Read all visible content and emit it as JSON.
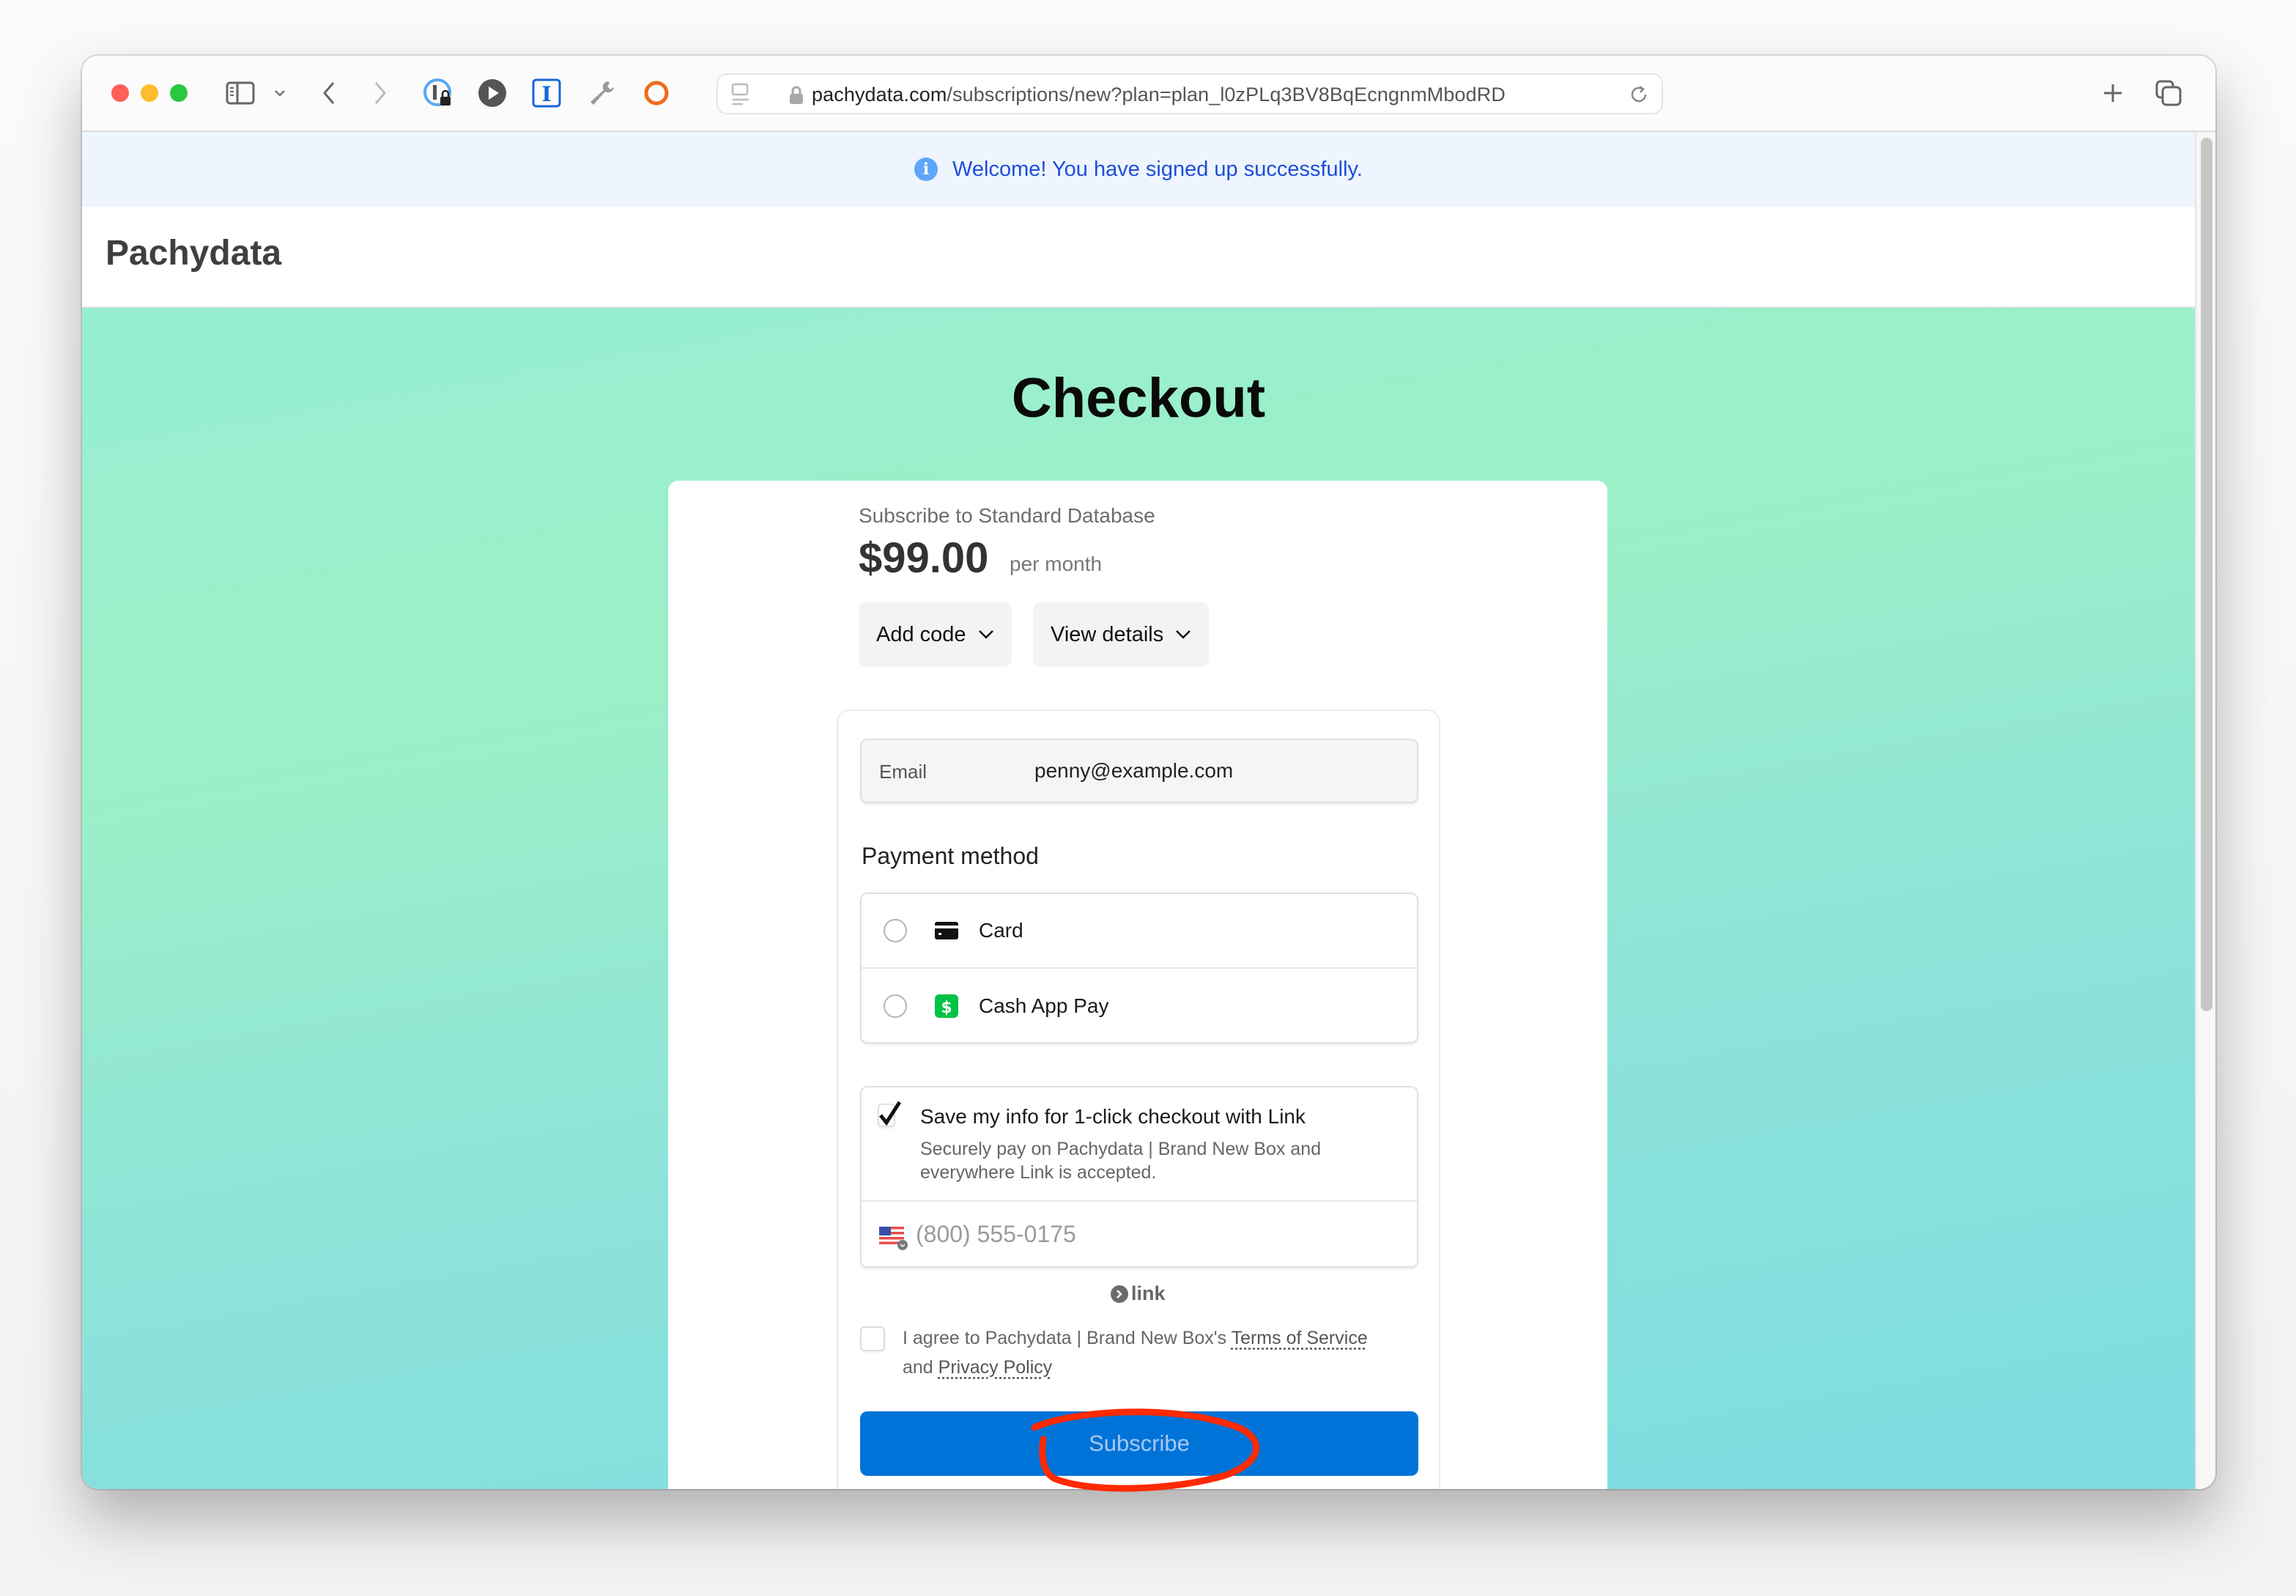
{
  "browser": {
    "url_host": "pachydata.com",
    "url_path": "/subscriptions/new?plan=plan_l0zPLq3BV8BqEcngnmMbodRD",
    "toolbar_icons": [
      "sidebar-icon",
      "chevron-down-icon",
      "back-icon",
      "forward-icon",
      "password-manager-icon",
      "play-icon",
      "text-cursor-icon",
      "wrench-icon",
      "circle-icon"
    ],
    "right_icons": [
      "new-tab-icon",
      "tab-overview-icon"
    ]
  },
  "flash": {
    "icon": "info-icon",
    "message": "Welcome! You have signed up successfully.",
    "color": "#1d4ed8"
  },
  "navbar": {
    "brand": "Pachydata"
  },
  "page": {
    "title": "Checkout"
  },
  "summary": {
    "subscribe_label": "Subscribe to Standard Database",
    "price": "$99.00",
    "interval": "per month",
    "add_code_label": "Add code",
    "view_details_label": "View details"
  },
  "form": {
    "email_label": "Email",
    "email_value": "penny@example.com",
    "payment_method_heading": "Payment method",
    "payment_methods": [
      {
        "label": "Card",
        "icon": "credit-card-icon",
        "selected": false
      },
      {
        "label": "Cash App Pay",
        "icon": "cash-app-icon",
        "selected": false
      }
    ],
    "link": {
      "checked": true,
      "label": "Save my info for 1-click checkout with Link",
      "description": "Securely pay on Pachydata | Brand New Box and everywhere Link is accepted.",
      "phone_placeholder": "(800) 555-0175",
      "country_flag": "us-flag-icon",
      "logo_text": "link"
    },
    "terms": {
      "checked": false,
      "prefix": "I agree to Pachydata | Brand New Box's ",
      "tos_link": "Terms of Service",
      "middle": " and ",
      "privacy_link": "Privacy Policy"
    },
    "submit_label": "Subscribe",
    "submit_color": "#0073d9"
  },
  "annotation": {
    "type": "red-circle",
    "target": "Subscribe",
    "color": "#ff2a00"
  }
}
